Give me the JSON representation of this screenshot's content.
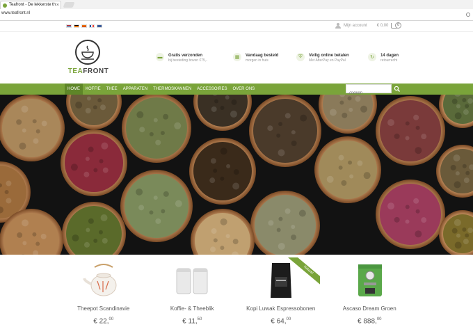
{
  "browser": {
    "tab_title": "Teafront - De lekkerste th",
    "tab_close": "×",
    "url": "www.teafront.nl"
  },
  "topbar": {
    "languages": [
      "nl",
      "de",
      "es",
      "fr",
      "en"
    ],
    "account_label": "Mijn account",
    "cart_total": "€ 0,00",
    "cart_count": "0"
  },
  "header": {
    "logo": {
      "part1": "TEA",
      "part2": "FRONT"
    },
    "usps": [
      {
        "icon": "truck-icon",
        "glyph": "🚚",
        "title": "Gratis verzonden",
        "subtitle": "bij besteding boven €75,-"
      },
      {
        "icon": "calendar-icon",
        "glyph": "▦",
        "title": "Vandaag besteld",
        "subtitle": "morgen in huis"
      },
      {
        "icon": "shield-icon",
        "glyph": "⛨",
        "title": "Veilig online betalen",
        "subtitle": "Met AfterPay en PayPal"
      },
      {
        "icon": "return-icon",
        "glyph": "↻",
        "title": "14 dagen",
        "subtitle": "retourrecht"
      }
    ]
  },
  "nav": {
    "items": [
      "HOME",
      "KOFFIE",
      "THEE",
      "APPARATEN",
      "THERMOSKANNEN",
      "ACCESSOIRES",
      "OVER ONS"
    ],
    "active_index": 0,
    "search_placeholder": "Zoeken"
  },
  "colors": {
    "brand_green": "#7aa43a",
    "nav_active": "#5e8628"
  },
  "products": [
    {
      "name": "Theepot Scandinavie",
      "price_main": "€ 22,",
      "price_cents": "00",
      "image": "teapot"
    },
    {
      "name": "Koffie- & Theeblik",
      "price_main": "€ 11,",
      "price_cents": "50",
      "image": "tins"
    },
    {
      "name": "Kopi Luwak Espressobonen",
      "price_main": "€ 64,",
      "price_cents": "00",
      "image": "coffee-bag",
      "badge": "Naturel"
    },
    {
      "name": "Ascaso Dream Groen",
      "price_main": "€ 888,",
      "price_cents": "00",
      "image": "espresso-machine"
    }
  ]
}
